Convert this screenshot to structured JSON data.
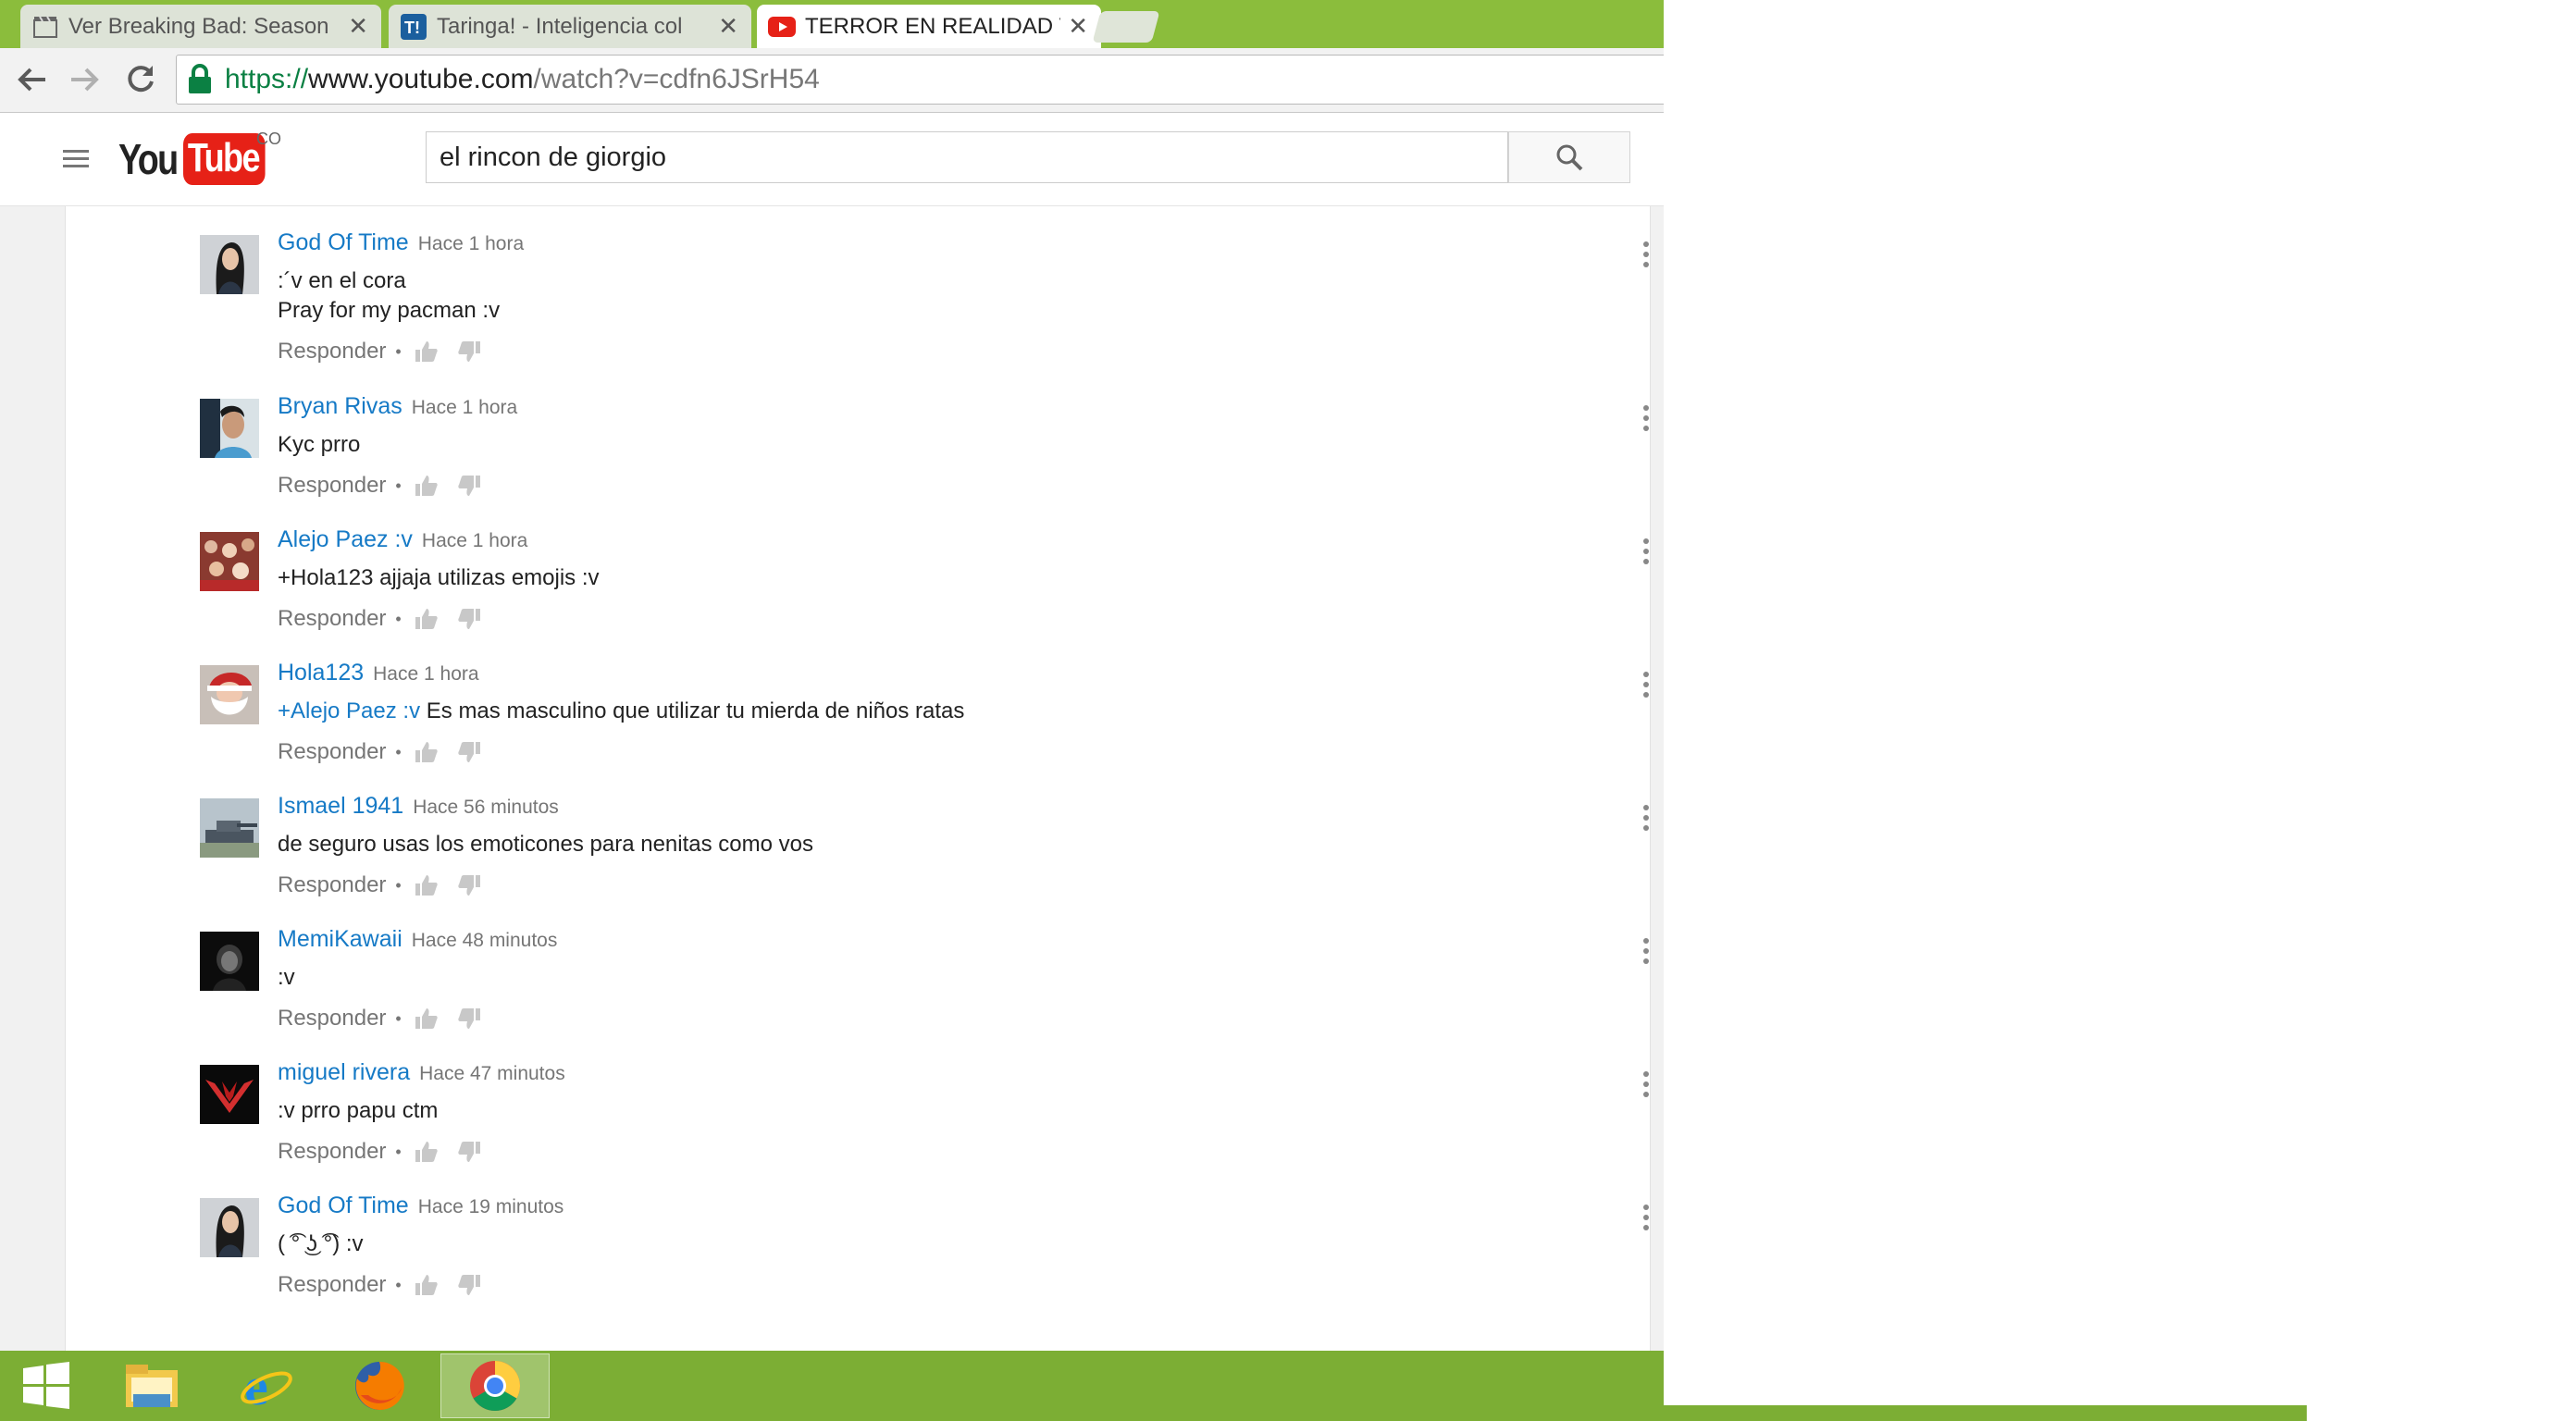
{
  "browser": {
    "tabs": [
      {
        "title": "Ver Breaking Bad: Season",
        "favicon": "film-icon",
        "active": false
      },
      {
        "title": "Taringa! - Inteligencia col",
        "favicon": "taringa-icon",
        "active": false
      },
      {
        "title": "TERROR EN REALIDAD VIF",
        "favicon": "youtube-icon",
        "active": true
      }
    ],
    "close_glyph": "✕",
    "url": {
      "scheme": "https://",
      "host": "www.youtube.com",
      "path": "/watch?v=cdfn6JSrH54"
    }
  },
  "youtube": {
    "logo_you": "You",
    "logo_tube": "Tube",
    "country": "CO",
    "search_value": "el rincon de giorgio"
  },
  "comments": [
    {
      "author": "God Of Time",
      "time": "Hace 1 hora",
      "lines": [
        {
          "mention": "",
          "text": ":´v en el cora"
        },
        {
          "mention": "",
          "text": "Pray for my pacman :v"
        }
      ],
      "reply": "Responder",
      "avatar": "woman-portrait"
    },
    {
      "author": "Bryan Rivas",
      "time": "Hace 1 hora",
      "lines": [
        {
          "mention": "",
          "text": "Kyc prro"
        }
      ],
      "reply": "Responder",
      "avatar": "man-portrait"
    },
    {
      "author": "Alejo Paez :v",
      "time": "Hace 1 hora",
      "lines": [
        {
          "mention": "",
          "text": "+Hola123 ajjaja utilizas emojis :v"
        }
      ],
      "reply": "Responder",
      "avatar": "crowd"
    },
    {
      "author": "Hola123",
      "time": "Hace 1 hora",
      "lines": [
        {
          "mention": "+Alejo Paez :v",
          "text": " Es mas masculino que utilizar tu mierda de niños ratas"
        }
      ],
      "reply": "Responder",
      "avatar": "santa"
    },
    {
      "author": "Ismael 1941",
      "time": "Hace 56 minutos",
      "lines": [
        {
          "mention": "",
          "text": "de seguro usas los emoticones para nenitas como vos"
        }
      ],
      "reply": "Responder",
      "avatar": "tank"
    },
    {
      "author": "MemiKawaii",
      "time": "Hace 48 minutos",
      "lines": [
        {
          "mention": "",
          "text": ":v"
        }
      ],
      "reply": "Responder",
      "avatar": "dark-girl"
    },
    {
      "author": "miguel rivera",
      "time": "Hace 47 minutos",
      "lines": [
        {
          "mention": "",
          "text": ":v prro papu ctm"
        }
      ],
      "reply": "Responder",
      "avatar": "red-emblem"
    },
    {
      "author": "God Of Time",
      "time": "Hace 19 minutos",
      "lines": [
        {
          "mention": "",
          "text": "( ͡° ͜ʖ ͡°) :v"
        }
      ],
      "reply": "Responder",
      "avatar": "woman-portrait"
    }
  ],
  "separator": "•",
  "taskbar": {
    "items": [
      {
        "name": "windows-start-icon",
        "active": false
      },
      {
        "name": "file-explorer-icon",
        "active": false
      },
      {
        "name": "internet-explorer-icon",
        "active": false
      },
      {
        "name": "firefox-icon",
        "active": false
      },
      {
        "name": "chrome-icon",
        "active": true
      }
    ]
  },
  "colors": {
    "tabstrip": "#8bbd3c",
    "taskbar": "#7cae34",
    "link_blue": "#167ac6",
    "youtube_red": "#e62117"
  }
}
